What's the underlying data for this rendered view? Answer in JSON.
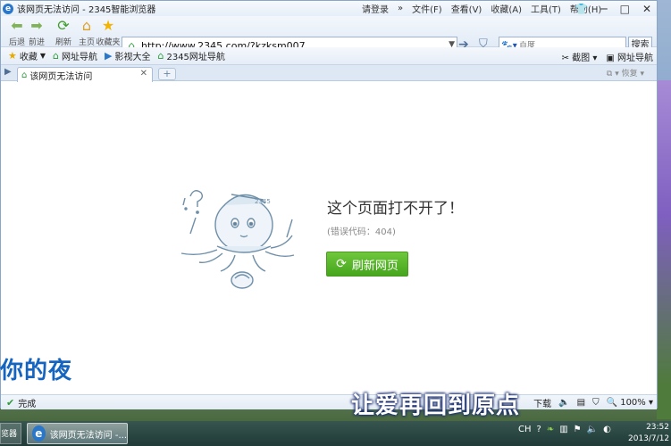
{
  "window": {
    "title": "该网页无法访问 - 2345智能浏览器",
    "menu": [
      "请登录",
      "»",
      "文件(F)",
      "查看(V)",
      "收藏(A)",
      "工具(T)",
      "帮助(H)"
    ]
  },
  "nav": {
    "back": "后退",
    "forward": "前进",
    "refresh": "刷新",
    "home": "主页",
    "favorites": "收藏夹"
  },
  "address": {
    "url": "http://www.2345.com/?kzksm007"
  },
  "search": {
    "placeholder": "百度",
    "button": "搜索"
  },
  "favbar": {
    "items": [
      "收藏",
      "网址导航",
      "影视大全",
      "2345网址导航"
    ],
    "right": [
      "截图",
      "网址导航"
    ]
  },
  "tabs": [
    {
      "label": "该网页无法访问"
    }
  ],
  "tabbar": {
    "restore": "恢复"
  },
  "error": {
    "title": "这个页面打不开了！",
    "code": "(错误代码：404)",
    "refresh_button": "刷新网页"
  },
  "overlay_left_text": "你的夜",
  "status": {
    "done": "完成",
    "download": "下载",
    "zoom": "100%"
  },
  "caption": "让爱再回到原点",
  "taskbar": {
    "prev_item": "览器",
    "active_item": "该网页无法访问 -...",
    "tray_lang": "CH",
    "time": "23:52",
    "date": "2013/7/12"
  }
}
